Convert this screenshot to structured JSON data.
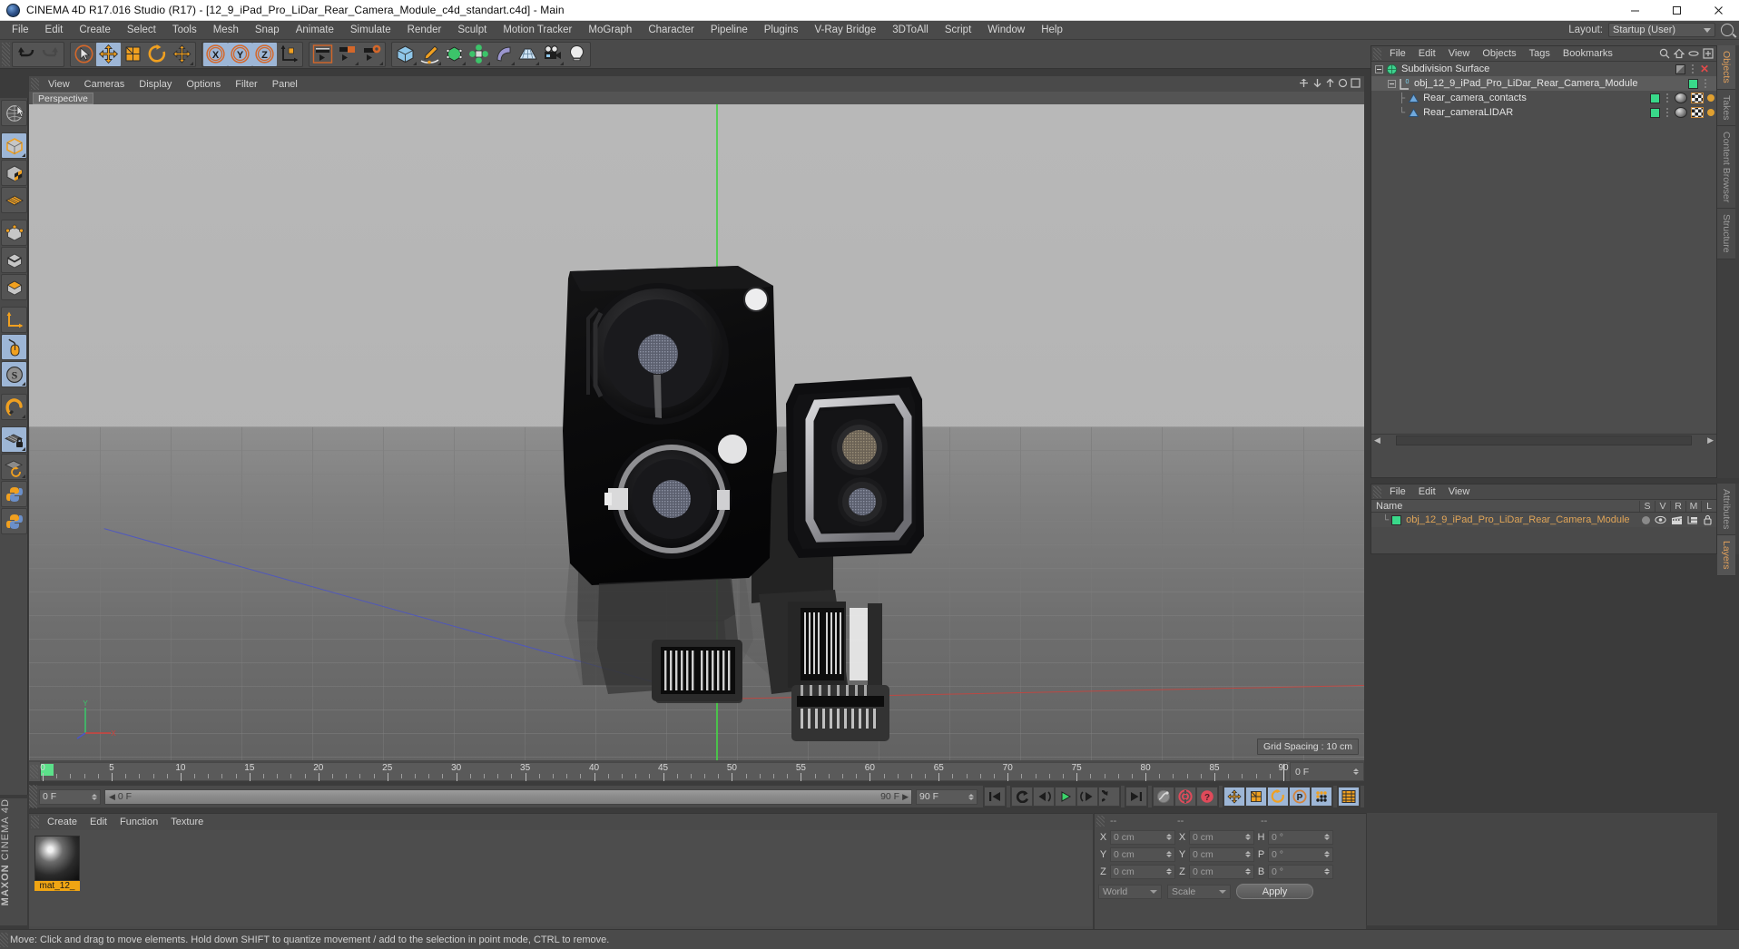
{
  "window": {
    "title": "CINEMA 4D R17.016 Studio (R17) - [12_9_iPad_Pro_LiDar_Rear_Camera_Module_c4d_standart.c4d] - Main",
    "minimize": "minimize-icon",
    "maximize": "maximize-icon",
    "close": "close-icon"
  },
  "menubar": {
    "items": [
      "File",
      "Edit",
      "Create",
      "Select",
      "Tools",
      "Mesh",
      "Snap",
      "Animate",
      "Simulate",
      "Render",
      "Sculpt",
      "Motion Tracker",
      "MoGraph",
      "Character",
      "Pipeline",
      "Plugins",
      "V-Ray Bridge",
      "3DToAll",
      "Script",
      "Window",
      "Help"
    ],
    "layout_label": "Layout:",
    "layout_value": "Startup (User)",
    "search_icon": "search-icon"
  },
  "toolbar": {
    "groups": [
      {
        "name": "undo-redo",
        "buttons": [
          {
            "icon": "undo-icon",
            "active": false,
            "dim": false
          },
          {
            "icon": "redo-icon",
            "active": false,
            "dim": true
          }
        ]
      },
      {
        "name": "transform-tools",
        "buttons": [
          {
            "icon": "select-cursor-icon",
            "active": false,
            "dim": false
          },
          {
            "icon": "move-icon",
            "active": true,
            "dim": false
          },
          {
            "icon": "scale-icon",
            "active": false,
            "dim": false
          },
          {
            "icon": "rotate-icon",
            "active": false,
            "dim": false
          },
          {
            "icon": "move-alt-icon",
            "active": false,
            "dim": false
          }
        ]
      },
      {
        "name": "axis-locks",
        "buttons": [
          {
            "icon": "x-axis-icon",
            "active": true,
            "dim": false
          },
          {
            "icon": "y-axis-icon",
            "active": true,
            "dim": false
          },
          {
            "icon": "z-axis-icon",
            "active": true,
            "dim": false
          },
          {
            "icon": "world-axis-icon",
            "active": false,
            "dim": false
          }
        ]
      },
      {
        "name": "render-tools",
        "buttons": [
          {
            "icon": "render-view-icon",
            "active": false,
            "dim": false
          },
          {
            "icon": "render-region-icon",
            "active": false,
            "dim": false
          },
          {
            "icon": "render-settings-icon",
            "active": false,
            "dim": false
          }
        ]
      },
      {
        "name": "object-creation",
        "buttons": [
          {
            "icon": "cube-primitive-icon",
            "active": false,
            "dim": false
          },
          {
            "icon": "spline-pen-icon",
            "active": false,
            "dim": false
          },
          {
            "icon": "generator-nurbs-icon",
            "active": false,
            "dim": false
          },
          {
            "icon": "array-deformer-icon",
            "active": false,
            "dim": false
          },
          {
            "icon": "bend-deformer-icon",
            "active": false,
            "dim": false
          },
          {
            "icon": "floor-scene-icon",
            "active": false,
            "dim": false
          },
          {
            "icon": "camera-icon",
            "active": false,
            "dim": false
          },
          {
            "icon": "light-icon",
            "active": false,
            "dim": false
          }
        ]
      }
    ]
  },
  "left_toolbar": {
    "buttons": [
      {
        "icon": "live-selection-icon",
        "active": false
      },
      {
        "icon": "model-mode-icon",
        "active": true
      },
      {
        "icon": "texture-mode-icon",
        "active": false
      },
      {
        "icon": "workplane-mode-icon",
        "active": false
      },
      {
        "icon": "points-mode-icon",
        "active": false
      },
      {
        "icon": "edges-mode-icon",
        "active": false
      },
      {
        "icon": "polygons-mode-icon",
        "active": false
      },
      {
        "icon": "axis-modify-icon",
        "active": false
      },
      {
        "icon": "enable-axis-icon",
        "active": true
      },
      {
        "icon": "soft-selection-icon",
        "active": true
      },
      {
        "icon": "magnet-icon",
        "active": false
      },
      {
        "icon": "workplane-lock-icon",
        "active": true
      },
      {
        "icon": "workplane-rotate-icon",
        "active": false
      },
      {
        "icon": "python-script-icon",
        "active": false
      },
      {
        "icon": "python-script-2-icon",
        "active": false
      }
    ]
  },
  "viewport": {
    "menu": [
      "View",
      "Cameras",
      "Display",
      "Options",
      "Filter",
      "Panel"
    ],
    "tab": "Perspective",
    "grid_spacing": "Grid Spacing : 10 cm",
    "axis_labels": {
      "x": "X",
      "y": "Y",
      "z": "Z"
    },
    "colors": {
      "x_axis": "#d0403a",
      "y_axis": "#4a54c8",
      "z_axis": "#47d147"
    }
  },
  "object_manager": {
    "menu": [
      "File",
      "Edit",
      "View",
      "Objects",
      "Tags",
      "Bookmarks"
    ],
    "icons": [
      "search-icon",
      "home-icon",
      "ellipse-icon",
      "add-layer-icon"
    ],
    "rows": [
      {
        "label": "Subdivision Surface",
        "depth": 0,
        "icon": "subdivision-surface-icon",
        "visdot": "grey",
        "tags": []
      },
      {
        "label": "obj_12_9_iPad_Pro_LiDar_Rear_Camera_Module",
        "depth": 1,
        "icon": "null-object-icon",
        "visdot": "green",
        "tags": []
      },
      {
        "label": "Rear_camera_contacts",
        "depth": 2,
        "icon": "polygon-object-icon",
        "visdot": "green",
        "tags": [
          "material-tag",
          "texture-tag",
          "uv-tag"
        ]
      },
      {
        "label": "Rear_cameraLIDAR",
        "depth": 2,
        "icon": "polygon-object-icon",
        "visdot": "green",
        "tags": [
          "material-tag",
          "texture-tag",
          "uv-tag"
        ]
      }
    ],
    "side_tabs": [
      "Objects",
      "Takes",
      "Content Browser",
      "Structure"
    ]
  },
  "layer_manager": {
    "menu": [
      "File",
      "Edit",
      "View"
    ],
    "columns": [
      "Name",
      "S",
      "V",
      "R",
      "M",
      "L"
    ],
    "rows": [
      {
        "name": "obj_12_9_iPad_Pro_LiDar_Rear_Camera_Module",
        "color": "#39d98a"
      }
    ],
    "side_tabs": [
      "Attributes",
      "Layers"
    ]
  },
  "timeline": {
    "ticks": [
      0,
      5,
      10,
      15,
      20,
      25,
      30,
      35,
      40,
      45,
      50,
      55,
      60,
      65,
      70,
      75,
      80,
      85,
      90
    ],
    "min_frame": 0,
    "max_frame": 90,
    "current_frame_field": "0 F",
    "end_frame_field": "90 F",
    "preview_min": "0 F",
    "preview_max": "90 F",
    "right_field": "0 F"
  },
  "anim_toolbar": {
    "transport": [
      {
        "icon": "go-to-start-icon"
      },
      {
        "icon": "play-reverse-icon"
      },
      {
        "icon": "step-back-icon"
      },
      {
        "icon": "play-forward-icon"
      },
      {
        "icon": "step-forward-icon"
      },
      {
        "icon": "play-loop-icon"
      },
      {
        "icon": "go-to-end-icon"
      }
    ],
    "record_group": [
      {
        "icon": "autokey-curve-icon",
        "active": false
      },
      {
        "icon": "record-keyframe-icon",
        "active": false
      },
      {
        "icon": "autokeying-icon",
        "active": false
      }
    ],
    "key_group": [
      {
        "icon": "key-position-icon",
        "active": true
      },
      {
        "icon": "key-scale-icon",
        "active": true
      },
      {
        "icon": "key-rotation-icon",
        "active": true
      },
      {
        "icon": "key-parameter-icon",
        "active": true
      },
      {
        "icon": "key-pla-icon",
        "active": true
      }
    ],
    "last_group": [
      {
        "icon": "timeline-window-icon",
        "active": true
      }
    ]
  },
  "material_manager": {
    "menu": [
      "Create",
      "Edit",
      "Function",
      "Texture"
    ],
    "materials": [
      {
        "name": "mat_12_",
        "preview": "material-sphere-preview"
      }
    ]
  },
  "coordinates": {
    "header": [
      "--",
      "--",
      "--"
    ],
    "rows": [
      {
        "pos_label": "X",
        "pos_value": "0 cm",
        "size_label": "X",
        "size_value": "0 cm",
        "rot_label": "H",
        "rot_value": "0 °"
      },
      {
        "pos_label": "Y",
        "pos_value": "0 cm",
        "size_label": "Y",
        "size_value": "0 cm",
        "rot_label": "P",
        "rot_value": "0 °"
      },
      {
        "pos_label": "Z",
        "pos_value": "0 cm",
        "size_label": "Z",
        "size_value": "0 cm",
        "rot_label": "B",
        "rot_value": "0 °"
      }
    ],
    "space_select": "World",
    "mode_select": "Scale",
    "apply_label": "Apply"
  },
  "statusbar": {
    "message": "Move: Click and drag to move elements. Hold down SHIFT to quantize movement / add to the selection in point mode, CTRL to remove."
  },
  "brand": {
    "line1": "MAXON",
    "line2": "CINEMA 4D"
  }
}
